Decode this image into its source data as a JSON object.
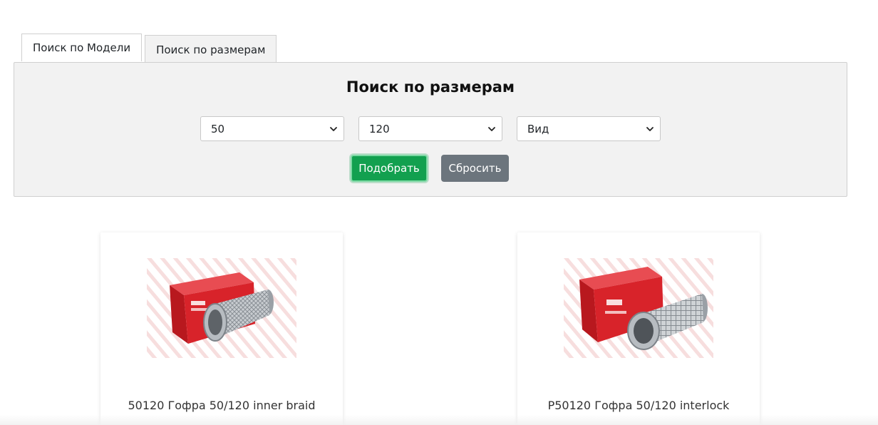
{
  "tabs": [
    {
      "label": "Поиск по Модели",
      "active": false
    },
    {
      "label": "Поиск по размерам",
      "active": true
    }
  ],
  "panel": {
    "title": "Поиск по размерам",
    "selects": [
      {
        "value": "50"
      },
      {
        "value": "120"
      },
      {
        "value": "Вид"
      }
    ],
    "buttons": {
      "submit_label": "Подобрать",
      "reset_label": "Сбросить"
    }
  },
  "products": [
    {
      "title": "50120 Гофра 50/120 inner braid",
      "image_icon": "exhaust-flex-pipe-box-image"
    },
    {
      "title": "P50120 Гофра 50/120 interlock",
      "image_icon": "exhaust-flex-pipe-box-image"
    }
  ],
  "colors": {
    "primary": "#12a04f",
    "secondary": "#6c757d",
    "panel_bg": "#f2f2f2",
    "box_red": "#d8232a"
  }
}
